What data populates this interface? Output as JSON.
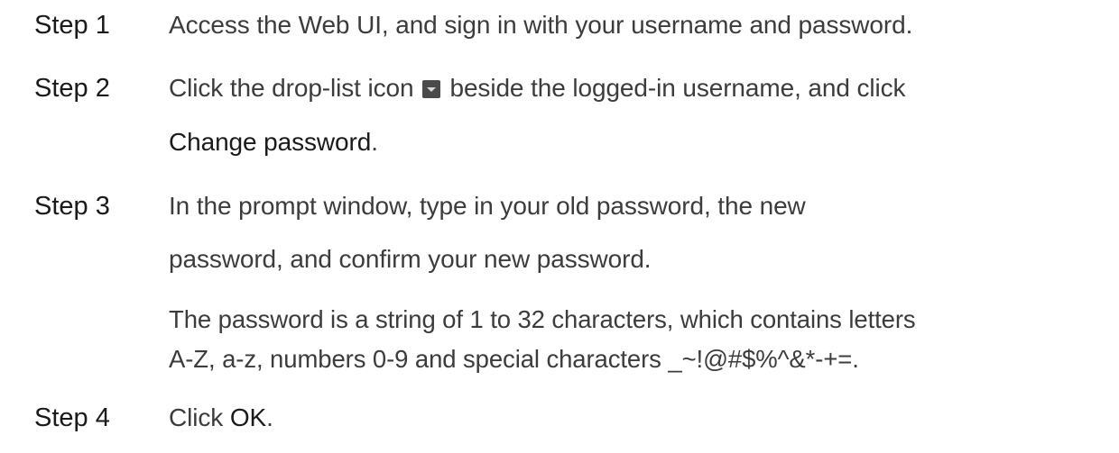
{
  "steps": [
    {
      "label": "Step 1",
      "text": "Access the Web UI, and sign in with your username and password."
    },
    {
      "label": "Step 2",
      "text_before_icon": "Click the drop-list icon",
      "icon": "drop-list-icon",
      "text_after_icon": "beside the logged-in username, and click",
      "emphasis": "Change password",
      "suffix": "."
    },
    {
      "label": "Step 3",
      "line1": "In the prompt window, type in your old password, the new",
      "line2": "password, and confirm your new password.",
      "note_line1": "The password is a string of 1 to 32 characters, which contains letters",
      "note_line2": "A-Z, a-z, numbers 0-9 and special characters _~!@#$%^&*-+=."
    },
    {
      "label": "Step 4",
      "text_before": "Click",
      "emphasis": "OK",
      "suffix": "."
    }
  ]
}
